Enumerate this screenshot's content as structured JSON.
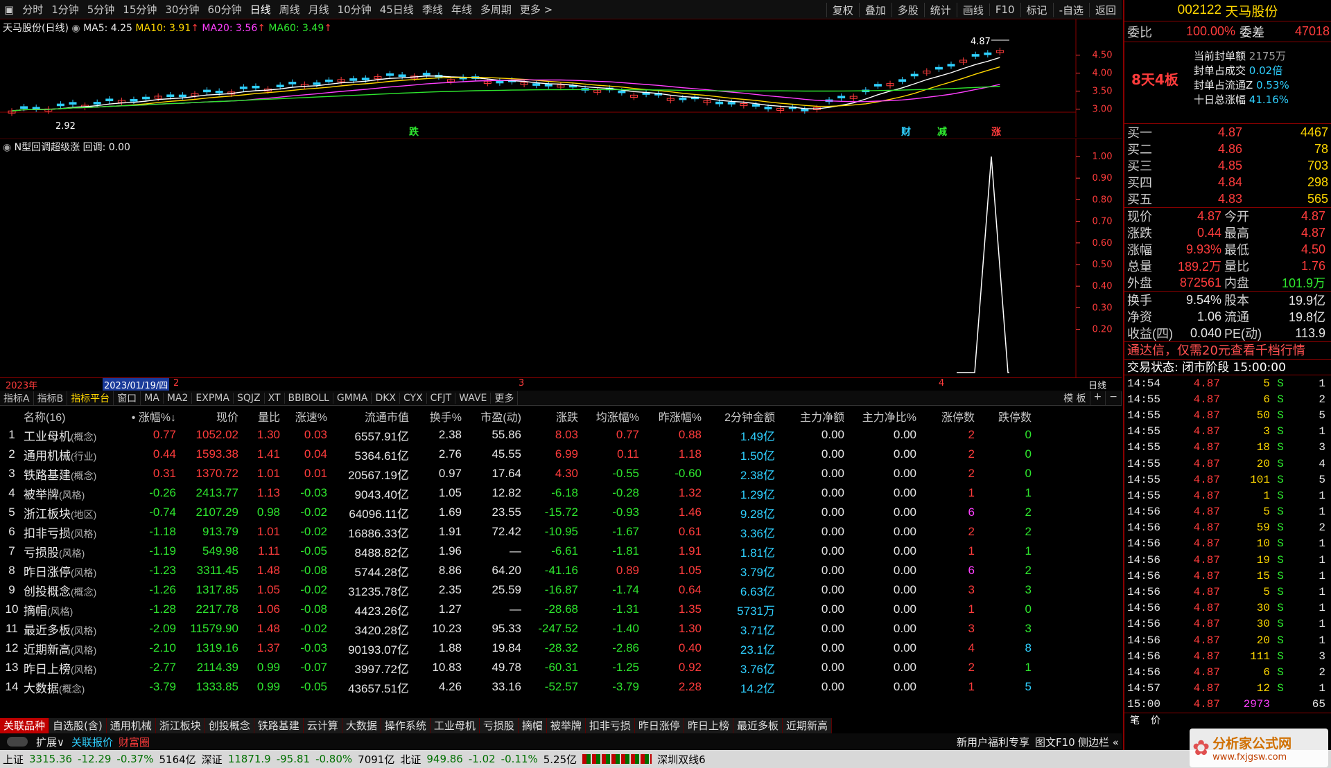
{
  "period_bar": [
    "分时",
    "1分钟",
    "5分钟",
    "15分钟",
    "30分钟",
    "60分钟",
    "日线",
    "周线",
    "月线",
    "10分钟",
    "45日线",
    "季线",
    "年线",
    "多周期",
    "更多 >"
  ],
  "period_active": "日线",
  "right_tools": [
    "复权",
    "叠加",
    "多股",
    "统计",
    "画线",
    "F10",
    "标记",
    "-自选",
    "返回"
  ],
  "kline": {
    "title": "天马股份(日线)",
    "ma5": "MA5: 4.25",
    "ma10": "MA10: 3.91",
    "ma20": "MA20: 3.56",
    "ma60": "MA60: 3.49",
    "high_label": "4.87",
    "low_label": "2.92",
    "y_ticks": [
      "4.50",
      "4.00",
      "3.50",
      "3.00"
    ],
    "markers": [
      "跌",
      "财",
      "减",
      "涨"
    ]
  },
  "indicator": {
    "title": "N型回调超级涨",
    "title2": "回调: 0.00",
    "y_ticks": [
      "1.00",
      "0.90",
      "0.80",
      "0.70",
      "0.60",
      "0.50",
      "0.40",
      "0.30",
      "0.20"
    ]
  },
  "datebar": {
    "year": "2023年",
    "cursor_date": "2023/01/19/四",
    "m2": "2",
    "m3": "3",
    "m4": "4",
    "right": "日线"
  },
  "ind_tabs": [
    "指标A",
    "指标B",
    "指标平台",
    "窗口",
    "MA",
    "MA2",
    "EXPMA",
    "SQJZ",
    "XT",
    "BBIBOLL",
    "GMMA",
    "DKX",
    "CYX",
    "CFJT",
    "WAVE",
    "更多"
  ],
  "ind_tabs_right": [
    "模 板",
    "+",
    "−"
  ],
  "table": {
    "headers": [
      "",
      "名称(16)",
      "• 涨幅%↓",
      "现价",
      "量比",
      "涨速%",
      "流通市值",
      "换手%",
      "市盈(动)",
      "涨跌",
      "均涨幅%",
      "昨涨幅%",
      "2分钟金额",
      "主力净额",
      "主力净比%",
      "涨停数",
      "跌停数"
    ],
    "rows": [
      [
        "1",
        "工业母机",
        "(概念)",
        "0.77",
        "1052.02",
        "1.30",
        "0.03",
        "6557.91亿",
        "2.38",
        "55.86",
        "8.03",
        "0.77",
        "0.88",
        "1.49亿",
        "0.00",
        "0.00",
        "2",
        "0"
      ],
      [
        "2",
        "通用机械",
        "(行业)",
        "0.44",
        "1593.38",
        "1.41",
        "0.04",
        "5364.61亿",
        "2.76",
        "45.55",
        "6.99",
        "0.11",
        "1.18",
        "1.50亿",
        "0.00",
        "0.00",
        "2",
        "0"
      ],
      [
        "3",
        "铁路基建",
        "(概念)",
        "0.31",
        "1370.72",
        "1.01",
        "0.01",
        "20567.19亿",
        "0.97",
        "17.64",
        "4.30",
        "-0.55",
        "-0.60",
        "2.38亿",
        "0.00",
        "0.00",
        "2",
        "0"
      ],
      [
        "4",
        "被举牌",
        "(风格)",
        "-0.26",
        "2413.77",
        "1.13",
        "-0.03",
        "9043.40亿",
        "1.05",
        "12.82",
        "-6.18",
        "-0.28",
        "1.32",
        "1.29亿",
        "0.00",
        "0.00",
        "1",
        "1"
      ],
      [
        "5",
        "浙江板块",
        "(地区)",
        "-0.74",
        "2107.29",
        "0.98",
        "-0.02",
        "64096.11亿",
        "1.69",
        "23.55",
        "-15.72",
        "-0.93",
        "1.46",
        "9.28亿",
        "0.00",
        "0.00",
        "6",
        "2"
      ],
      [
        "6",
        "扣非亏损",
        "(风格)",
        "-1.18",
        "913.79",
        "1.01",
        "-0.02",
        "16886.33亿",
        "1.91",
        "72.42",
        "-10.95",
        "-1.67",
        "0.61",
        "3.36亿",
        "0.00",
        "0.00",
        "2",
        "2"
      ],
      [
        "7",
        "亏损股",
        "(风格)",
        "-1.19",
        "549.98",
        "1.11",
        "-0.05",
        "8488.82亿",
        "1.96",
        "—",
        "-6.61",
        "-1.81",
        "1.91",
        "1.81亿",
        "0.00",
        "0.00",
        "1",
        "1"
      ],
      [
        "8",
        "昨日涨停",
        "(风格)",
        "-1.23",
        "3311.45",
        "1.48",
        "-0.08",
        "5744.28亿",
        "8.86",
        "64.20",
        "-41.16",
        "0.89",
        "1.05",
        "3.79亿",
        "0.00",
        "0.00",
        "6",
        "2"
      ],
      [
        "9",
        "创投概念",
        "(概念)",
        "-1.26",
        "1317.85",
        "1.05",
        "-0.02",
        "31235.78亿",
        "2.35",
        "25.59",
        "-16.87",
        "-1.74",
        "0.64",
        "6.63亿",
        "0.00",
        "0.00",
        "3",
        "3"
      ],
      [
        "10",
        "摘帽",
        "(风格)",
        "-1.28",
        "2217.78",
        "1.06",
        "-0.08",
        "4423.26亿",
        "1.27",
        "—",
        "-28.68",
        "-1.31",
        "1.35",
        "5731万",
        "0.00",
        "0.00",
        "1",
        "0"
      ],
      [
        "11",
        "最近多板",
        "(风格)",
        "-2.09",
        "11579.90",
        "1.48",
        "-0.02",
        "3420.28亿",
        "10.23",
        "95.33",
        "-247.52",
        "-1.40",
        "1.30",
        "3.71亿",
        "0.00",
        "0.00",
        "3",
        "3"
      ],
      [
        "12",
        "近期新高",
        "(风格)",
        "-2.10",
        "1319.16",
        "1.37",
        "-0.03",
        "90193.07亿",
        "1.88",
        "19.84",
        "-28.32",
        "-2.86",
        "0.40",
        "23.1亿",
        "0.00",
        "0.00",
        "4",
        "8"
      ],
      [
        "13",
        "昨日上榜",
        "(风格)",
        "-2.77",
        "2114.39",
        "0.99",
        "-0.07",
        "3997.72亿",
        "10.83",
        "49.78",
        "-60.31",
        "-1.25",
        "0.92",
        "3.76亿",
        "0.00",
        "0.00",
        "2",
        "1"
      ],
      [
        "14",
        "大数据",
        "(概念)",
        "-3.79",
        "1333.85",
        "0.99",
        "-0.05",
        "43657.51亿",
        "4.26",
        "33.16",
        "-52.57",
        "-3.79",
        "2.28",
        "14.2亿",
        "0.00",
        "0.00",
        "1",
        "5"
      ]
    ]
  },
  "block_tabs": [
    "关联品种",
    "自选股(含)",
    "通用机械",
    "浙江板块",
    "创投概念",
    "铁路基建",
    "云计算",
    "大数据",
    "操作系统",
    "工业母机",
    "亏损股",
    "摘帽",
    "被举牌",
    "扣非亏损",
    "昨日涨停",
    "昨日上榜",
    "最近多板",
    "近期新高"
  ],
  "subbar": {
    "expand": "扩展∨",
    "related": "关联报价",
    "wealth": "财富圈",
    "right1": "新用户福利专享",
    "right2": "图文F10",
    "right3": "侧边栏 «"
  },
  "statusbar": {
    "sh_label": "上证",
    "sh": "3315.36",
    "sh_chg": "-12.29",
    "sh_pct": "-0.37%",
    "sh_amt": "5164亿",
    "sz_label": "深证",
    "sz": "11871.9",
    "sz_chg": "-95.81",
    "sz_pct": "-0.80%",
    "sz_amt": "7091亿",
    "bz_label": "北证",
    "bz": "949.86",
    "bz_chg": "-1.02",
    "bz_pct": "-0.11%",
    "bz_amt": "5.25亿",
    "line": "深圳双线6"
  },
  "stock": {
    "code": "002122",
    "name": "天马股份"
  },
  "weibi": {
    "l1": "委比",
    "v1": "100.00%",
    "l2": "委差",
    "v2": "47018"
  },
  "seal": {
    "board": "8天4板",
    "items": [
      [
        "当前封单额",
        "2175万"
      ],
      [
        "封单占成交",
        "0.02倍"
      ],
      [
        "封单占流通Z",
        "0.53%"
      ],
      [
        "十日总涨幅",
        "41.16%"
      ]
    ]
  },
  "bids": [
    [
      "买一",
      "4.87",
      "4467"
    ],
    [
      "买二",
      "4.86",
      "78"
    ],
    [
      "买三",
      "4.85",
      "703"
    ],
    [
      "买四",
      "4.84",
      "298"
    ],
    [
      "买五",
      "4.83",
      "565"
    ]
  ],
  "quote": [
    [
      "现价",
      "4.87",
      "今开",
      "4.87"
    ],
    [
      "涨跌",
      "0.44",
      "最高",
      "4.87"
    ],
    [
      "涨幅",
      "9.93%",
      "最低",
      "4.50"
    ],
    [
      "总量",
      "189.2万",
      "量比",
      "1.76"
    ],
    [
      "外盘",
      "872561",
      "内盘",
      "101.9万"
    ]
  ],
  "fund": [
    [
      "换手",
      "9.54%",
      "股本",
      "19.9亿"
    ],
    [
      "净资",
      "1.06",
      "流通",
      "19.8亿"
    ],
    [
      "收益(四)",
      "0.040",
      "PE(动)",
      "113.9"
    ]
  ],
  "promo": "通达信，仅需20元查看千档行情",
  "trade_state": "交易状态: 闭市阶段 15:00:00",
  "ticks": [
    [
      "14:54",
      "4.87",
      "5",
      "S",
      "1"
    ],
    [
      "14:55",
      "4.87",
      "6",
      "S",
      "2"
    ],
    [
      "14:55",
      "4.87",
      "50",
      "S",
      "5"
    ],
    [
      "14:55",
      "4.87",
      "3",
      "S",
      "1"
    ],
    [
      "14:55",
      "4.87",
      "18",
      "S",
      "3"
    ],
    [
      "14:55",
      "4.87",
      "20",
      "S",
      "4"
    ],
    [
      "14:55",
      "4.87",
      "101",
      "S",
      "5"
    ],
    [
      "14:55",
      "4.87",
      "1",
      "S",
      "1"
    ],
    [
      "14:56",
      "4.87",
      "5",
      "S",
      "1"
    ],
    [
      "14:56",
      "4.87",
      "59",
      "S",
      "2"
    ],
    [
      "14:56",
      "4.87",
      "10",
      "S",
      "1"
    ],
    [
      "14:56",
      "4.87",
      "19",
      "S",
      "1"
    ],
    [
      "14:56",
      "4.87",
      "15",
      "S",
      "1"
    ],
    [
      "14:56",
      "4.87",
      "5",
      "S",
      "1"
    ],
    [
      "14:56",
      "4.87",
      "30",
      "S",
      "1"
    ],
    [
      "14:56",
      "4.87",
      "30",
      "S",
      "1"
    ],
    [
      "14:56",
      "4.87",
      "20",
      "S",
      "1"
    ],
    [
      "14:56",
      "4.87",
      "111",
      "S",
      "3"
    ],
    [
      "14:56",
      "4.87",
      "6",
      "S",
      "2"
    ],
    [
      "14:57",
      "4.87",
      "12",
      "S",
      "1"
    ],
    [
      "15:00",
      "4.87",
      "2973",
      "",
      "65"
    ]
  ],
  "watermark": {
    "title": "分析家公式网",
    "url": "www.fxjgsw.com"
  },
  "colors": {
    "up": "#ff3c3c",
    "down": "#2ee62e",
    "accent": "#c00000",
    "yellow": "#ffd700",
    "cyan": "#2fd0ff"
  }
}
